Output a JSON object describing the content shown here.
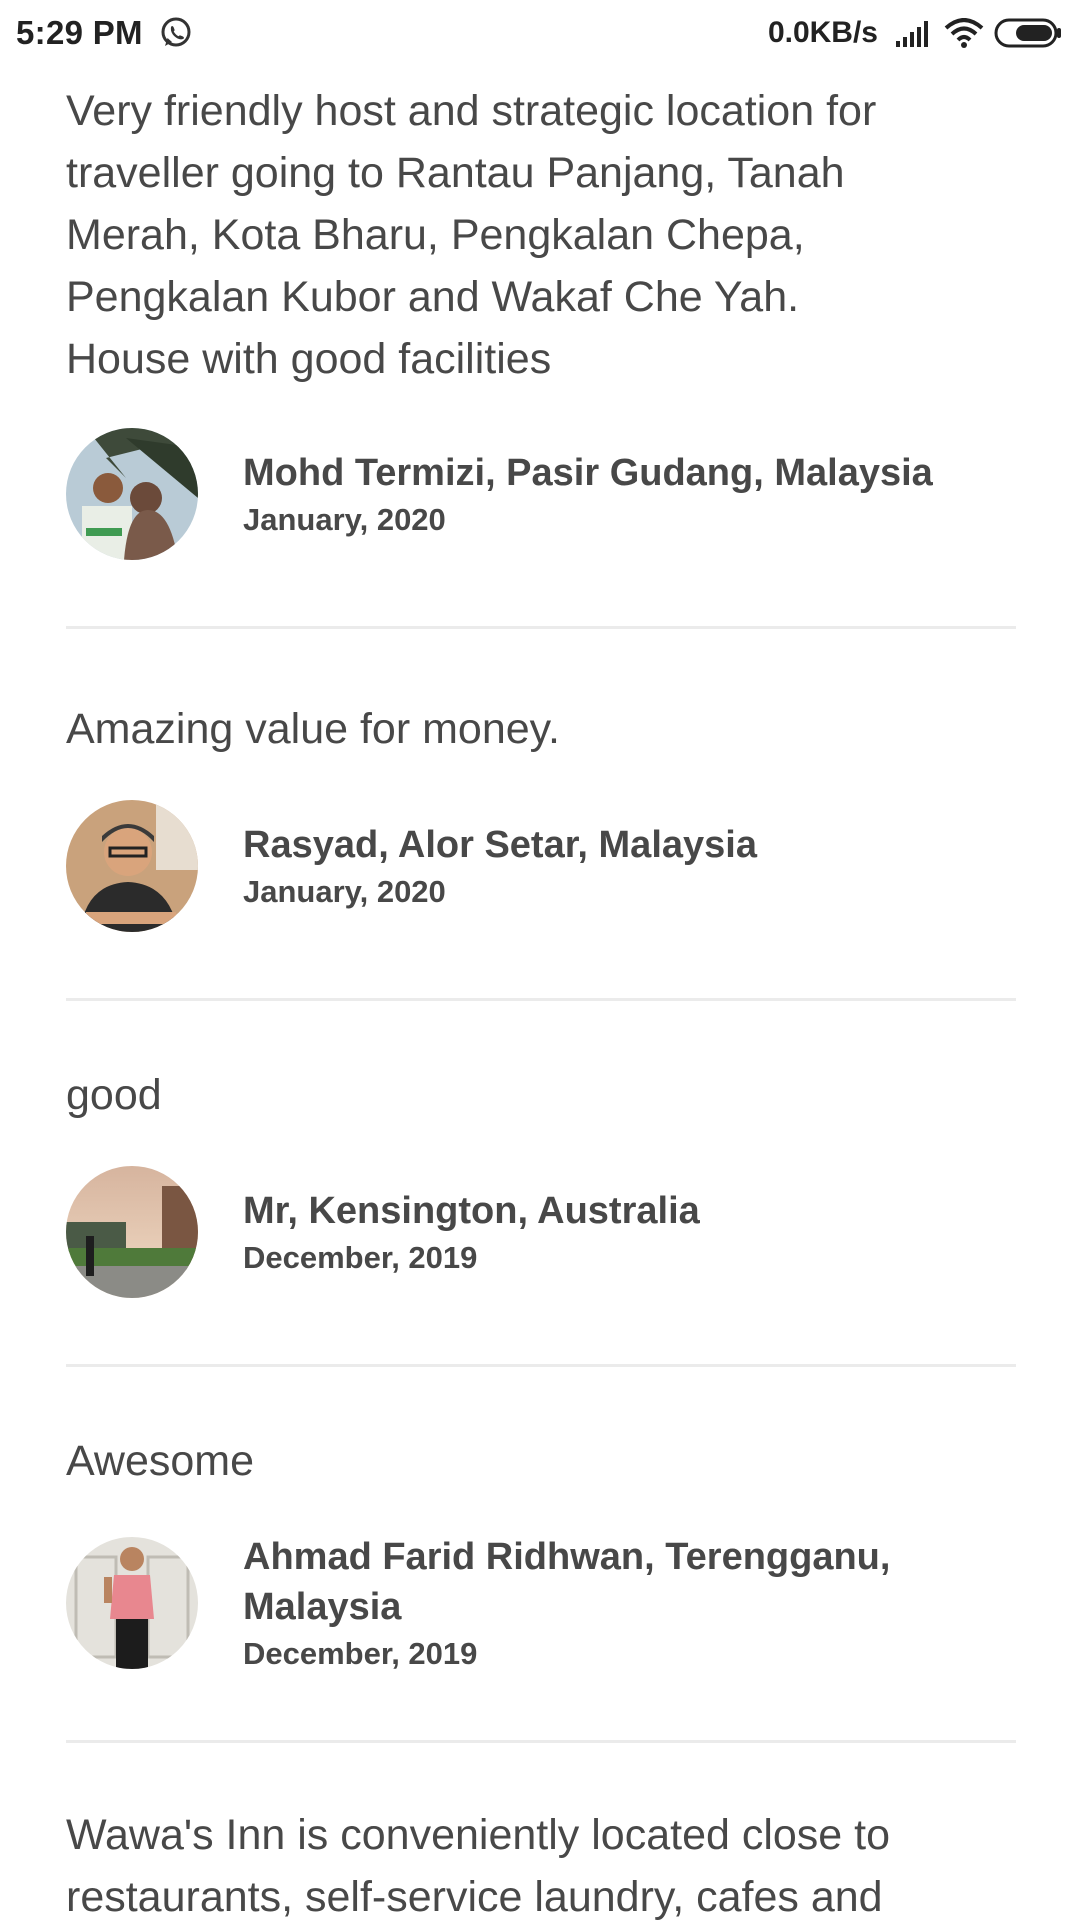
{
  "status_bar": {
    "time": "5:29 PM",
    "network_speed": "0.0KB/s",
    "icons": [
      "whatsapp-icon",
      "signal-icon",
      "wifi-icon",
      "battery-icon"
    ]
  },
  "reviews": [
    {
      "text_lines": [
        "Very friendly host and strategic location for",
        "traveller going to Rantau Panjang, Tanah",
        "Merah, Kota Bharu, Pengkalan Chepa,",
        "Pengkalan Kubor and Wakaf Che Yah.",
        "House with good facilities"
      ],
      "reviewer_name": "Mohd Termizi, Pasir Gudang, Malaysia",
      "date": "January, 2020"
    },
    {
      "text_lines": [
        "Amazing value for money."
      ],
      "reviewer_name": "Rasyad, Alor Setar, Malaysia",
      "date": "January, 2020"
    },
    {
      "text_lines": [
        "good"
      ],
      "reviewer_name": "Mr, Kensington, Australia",
      "date": "December, 2019"
    },
    {
      "text_lines": [
        "Awesome"
      ],
      "reviewer_name_lines": [
        "Ahmad Farid Ridhwan, Terengganu,",
        "Malaysia"
      ],
      "date": "December, 2019"
    }
  ],
  "description": {
    "text_lines": [
      "Wawa's Inn is conveniently located close to",
      "restaurants, self-service laundry, cafes and"
    ]
  }
}
